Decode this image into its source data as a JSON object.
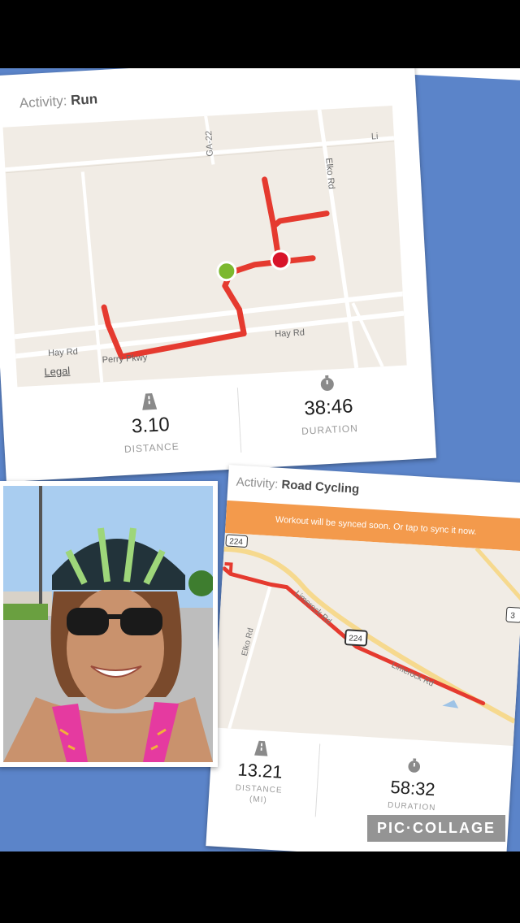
{
  "card_run": {
    "activity_prefix": "Activity:",
    "activity_type": "Run",
    "map": {
      "road_labels": [
        "GA-22",
        "Li",
        "Elko Rd",
        "Hay Rd",
        "Perry Pkwy",
        "Hay Rd"
      ],
      "legal": "Legal"
    },
    "stats": {
      "distance_icon": "road-icon",
      "distance_value": "3.10",
      "distance_label": "DISTANCE",
      "duration_icon": "stopwatch-icon",
      "duration_value": "38:46",
      "duration_label": "DURATION"
    }
  },
  "card_cycling": {
    "activity_prefix": "Activity:",
    "activity_type": "Road Cycling",
    "banner": "Workout will be synced soon. Or tap to sync it now.",
    "map": {
      "route_badges": [
        "224",
        "224",
        "3"
      ],
      "road_labels": [
        "Limerock Rd",
        "Elko Rd",
        "Limerock Rd"
      ]
    },
    "stats": {
      "distance_value": "13.21",
      "distance_label": "DISTANCE",
      "distance_unit": "(MI)",
      "duration_value": "58:32",
      "duration_label": "DURATION"
    }
  },
  "photo": {
    "description_icon": "selfie-photo"
  },
  "watermark": "PIC·COLLAGE",
  "colors": {
    "background": "#5b84c9",
    "route_red": "#e53a2f",
    "start_green": "#7cb82f",
    "banner_orange": "#f39a4c"
  }
}
